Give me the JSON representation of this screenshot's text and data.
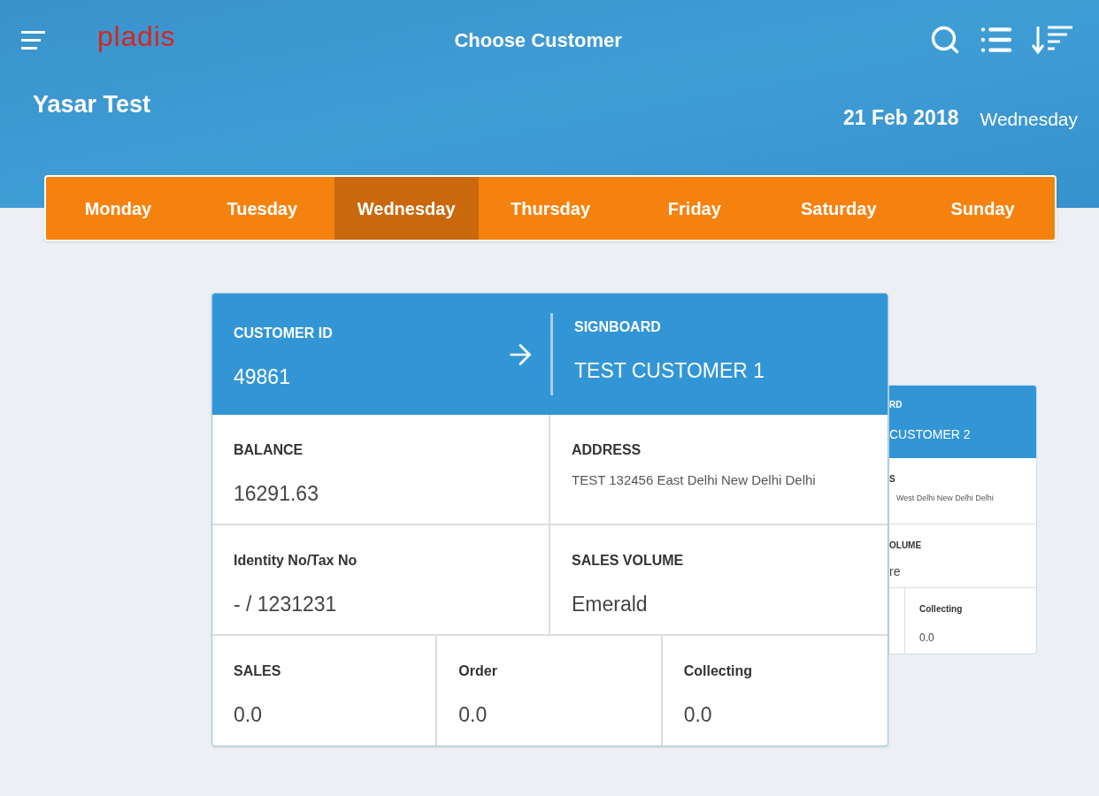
{
  "app_bar": {
    "logo": "pladis",
    "title": "Choose Customer"
  },
  "user": {
    "name": "Yasar Test"
  },
  "date": {
    "value": "21 Feb 2018",
    "weekday": "Wednesday"
  },
  "days": [
    {
      "label": "Monday",
      "selected": false
    },
    {
      "label": "Tuesday",
      "selected": false
    },
    {
      "label": "Wednesday",
      "selected": true
    },
    {
      "label": "Thursday",
      "selected": false
    },
    {
      "label": "Friday",
      "selected": false
    },
    {
      "label": "Saturday",
      "selected": false
    },
    {
      "label": "Sunday",
      "selected": false
    }
  ],
  "customer_card": {
    "customer_id_label": "CUSTOMER ID",
    "customer_id": "49861",
    "signboard_label": "SIGNBOARD",
    "signboard": "TEST CUSTOMER 1",
    "balance_label": "BALANCE",
    "balance": "16291.63",
    "address_label": "ADDRESS",
    "address": "TEST 132456 East Delhi New Delhi Delhi",
    "identity_label": "Identity No/Tax No",
    "identity": "- / 1231231",
    "sales_volume_label": "SALES VOLUME",
    "sales_volume": "Emerald",
    "totals": [
      {
        "label": "SALES",
        "value": "0.0"
      },
      {
        "label": "Order",
        "value": "0.0"
      },
      {
        "label": "Collecting",
        "value": "0.0"
      }
    ]
  },
  "next_card": {
    "signboard_label": "RD",
    "signboard": "CUSTOMER 2",
    "address_label": "S",
    "address": "West Delhi New Delhi Delhi",
    "sales_volume_label": "OLUME",
    "sales_volume": "re",
    "collecting_label": "Collecting",
    "collecting": "0.0"
  }
}
